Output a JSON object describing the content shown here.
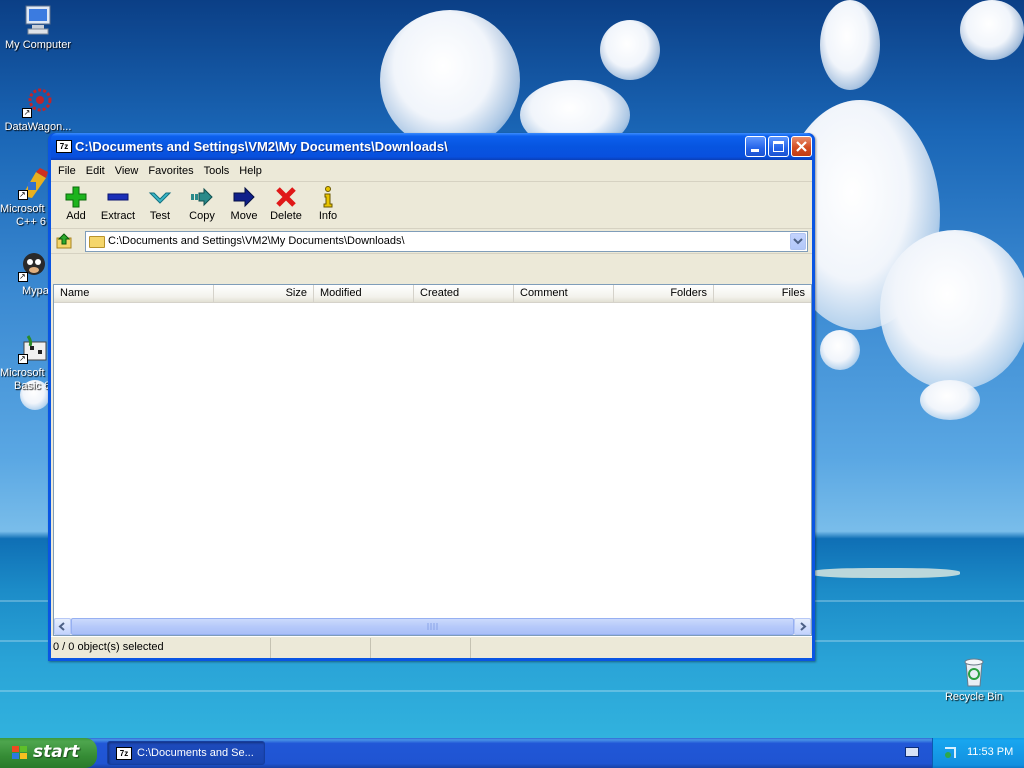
{
  "desktop": {
    "icons": [
      {
        "label": "My Computer",
        "icon": "my-computer-icon"
      },
      {
        "label": "DataWagon...",
        "icon": "datawagon-icon"
      },
      {
        "label": "Microsoft",
        "label2": "C++ 6",
        "icon": "visual-cpp-icon"
      },
      {
        "label": "Mypa",
        "icon": "mypa-icon"
      },
      {
        "label": "Microsoft",
        "label2": "Basic 6",
        "icon": "visual-basic-icon"
      },
      {
        "label": "Recycle Bin",
        "icon": "recycle-bin-icon"
      }
    ]
  },
  "window": {
    "title": "C:\\Documents and Settings\\VM2\\My Documents\\Downloads\\",
    "app_icon": "7z",
    "menu": [
      "File",
      "Edit",
      "View",
      "Favorites",
      "Tools",
      "Help"
    ],
    "toolbar": [
      {
        "label": "Add",
        "icon": "add-icon",
        "color": "#1db41d"
      },
      {
        "label": "Extract",
        "icon": "extract-icon",
        "color": "#1a2fb8"
      },
      {
        "label": "Test",
        "icon": "test-icon",
        "color": "#3cb8c8"
      },
      {
        "label": "Copy",
        "icon": "copy-icon",
        "color": "#2a8a8a"
      },
      {
        "label": "Move",
        "icon": "move-icon",
        "color": "#10208a"
      },
      {
        "label": "Delete",
        "icon": "delete-icon",
        "color": "#e01818"
      },
      {
        "label": "Info",
        "icon": "info-icon",
        "color": "#e8c400"
      }
    ],
    "address": "C:\\Documents and Settings\\VM2\\My Documents\\Downloads\\",
    "columns": [
      "Name",
      "Size",
      "Modified",
      "Created",
      "Comment",
      "Folders",
      "Files"
    ],
    "rows": [],
    "status": [
      "0 / 0 object(s) selected",
      "",
      "",
      ""
    ]
  },
  "taskbar": {
    "start": "start",
    "task_app_icon": "7z",
    "task_label": "C:\\Documents and Se...",
    "clock": "11:53 PM"
  }
}
